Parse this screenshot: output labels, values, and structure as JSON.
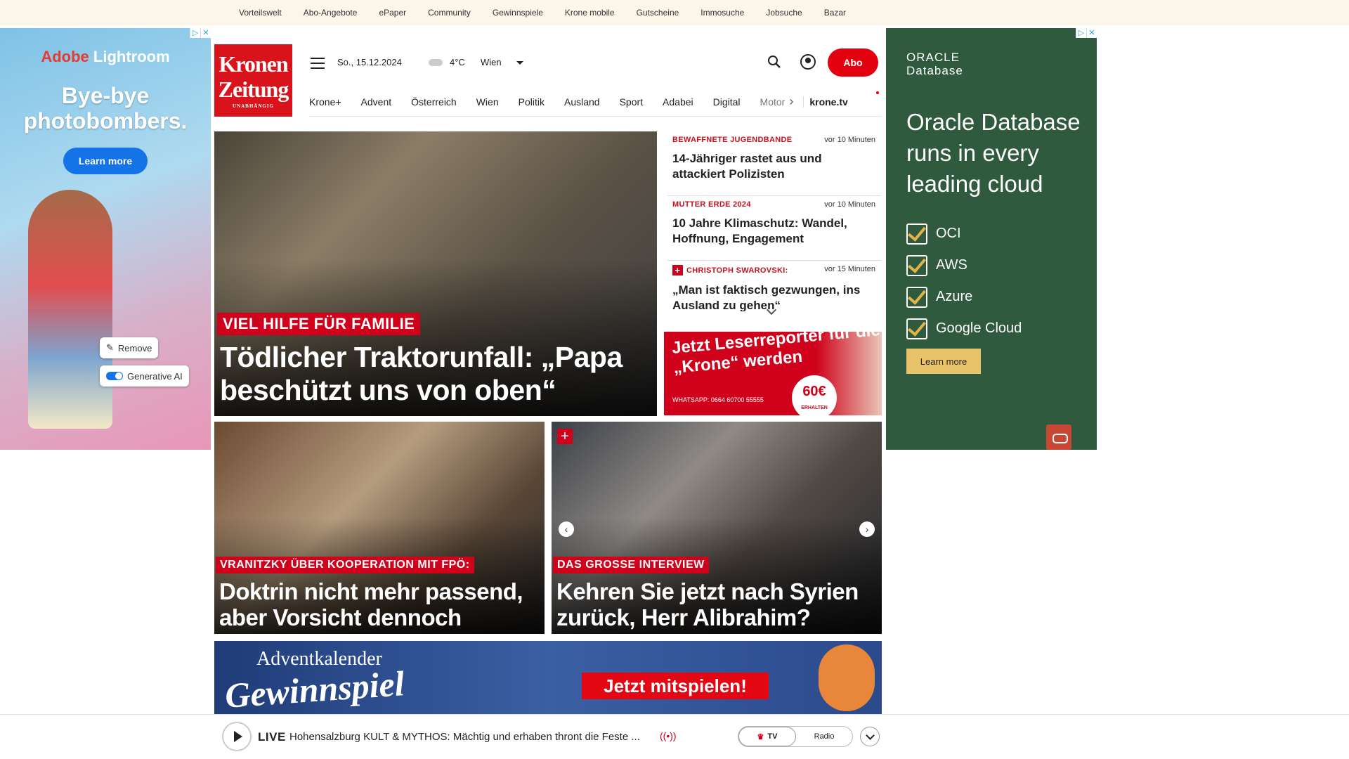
{
  "topbar": {
    "links": [
      "Vorteilswelt",
      "Abo-Angebote",
      "ePaper",
      "Community",
      "Gewinnspiele",
      "Krone mobile",
      "Gutscheine",
      "Immosuche",
      "Jobsuche",
      "Bazar"
    ]
  },
  "ad_left": {
    "brand_adobe": "Adobe",
    "brand_product": "Lightroom",
    "headline": "Bye-bye photobombers.",
    "cta": "Learn more",
    "remove_label": "Remove",
    "genai_label": "Generative AI"
  },
  "ad_right": {
    "logo_line1": "ORACLE",
    "logo_line2": "Database",
    "headline": "Oracle Database runs in every leading cloud",
    "clouds": [
      "OCI",
      "AWS",
      "Azure",
      "Google Cloud"
    ],
    "cta": "Learn more"
  },
  "header": {
    "logo_line1": "Kronen",
    "logo_line2": "Zeitung",
    "logo_tagline": "UNABHÄNGIG",
    "date": "So., 15.12.2024",
    "temperature": "4°C",
    "city": "Wien",
    "abo_label": "Abo"
  },
  "nav": {
    "items": [
      "Krone+",
      "Advent",
      "Österreich",
      "Wien",
      "Politik",
      "Ausland",
      "Sport",
      "Adabei",
      "Digital"
    ],
    "truncated_item": "Motor",
    "krone_tv": "krone.tv"
  },
  "hero": {
    "kicker": "VIEL HILFE FÜR FAMILIE",
    "headline": "Tödlicher Traktorunfall: „Papa beschützt uns von oben“"
  },
  "ticker": [
    {
      "category": "BEWAFFNETE JUGENDBANDE",
      "time": "vor 10 Minuten",
      "headline": "14-Jähriger rastet aus und attackiert Polizisten"
    },
    {
      "category": "MUTTER ERDE 2024",
      "time": "vor 10 Minuten",
      "headline": "10 Jahre Klimaschutz: Wandel, Hoffnung, Engagement"
    },
    {
      "category": "CHRISTOPH SWAROVSKI:",
      "time": "vor 15 Minuten",
      "headline": "„Man ist faktisch gezwungen, ins Ausland zu gehen“"
    }
  ],
  "leserreporter": {
    "text": "Jetzt Leserreporter für die „Krone“ werden",
    "whatsapp": "WHATSAPP: 0664 60700 55555",
    "amount": "60€",
    "amount_label": "ERHALTEN"
  },
  "cards": [
    {
      "kicker": "VRANITZKY ÜBER KOOPERATION MIT FPÖ:",
      "headline": "Doktrin nicht mehr passend, aber Vorsicht dennoch geboten"
    },
    {
      "kicker": "DAS GROSSE INTERVIEW",
      "headline": "Kehren Sie jetzt nach Syrien zurück, Herr Alibrahim?"
    }
  ],
  "advent": {
    "line1": "Adventkalender",
    "line2": "Gewinnspiel",
    "cta": "Jetzt mitspielen!"
  },
  "player": {
    "live_label": "LIVE",
    "title": "Hohensalzburg KULT & MYTHOS: Mächtig und erhaben thront die Feste ...",
    "tv_label": "TV",
    "radio_label": "Radio"
  }
}
